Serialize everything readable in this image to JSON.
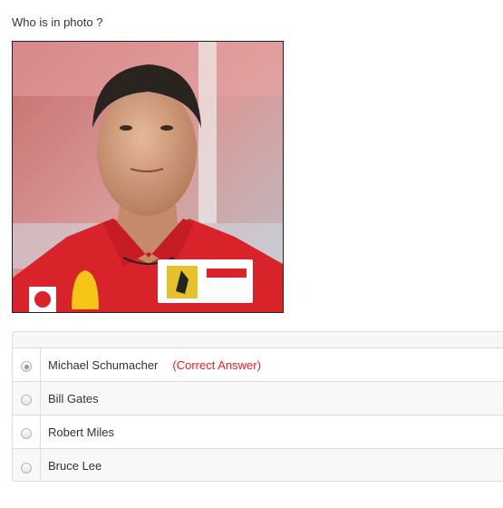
{
  "question": {
    "text": "Who is in photo ?"
  },
  "photo": {
    "subject": "portrait photo of a racing driver in a red team shirt"
  },
  "answers": [
    {
      "label": "Michael Schumacher",
      "selected": true,
      "note": "(Correct Answer)"
    },
    {
      "label": "Bill Gates",
      "selected": false,
      "note": ""
    },
    {
      "label": "Robert Miles",
      "selected": false,
      "note": ""
    },
    {
      "label": "Bruce Lee",
      "selected": false,
      "note": ""
    }
  ],
  "colors": {
    "correct_note": "#e8202b",
    "shirt_red": "#d9232b",
    "border": "#dcdcdc"
  }
}
